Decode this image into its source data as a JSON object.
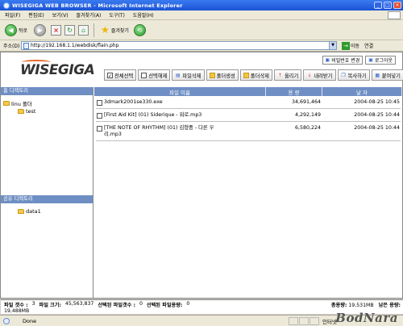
{
  "window": {
    "title": "WISEGIGA WEB BROWSER - Microsoft Internet Explorer",
    "controls": [
      "_",
      "□",
      "×"
    ]
  },
  "menu": [
    "파일(F)",
    "편집(E)",
    "보기(V)",
    "즐겨찾기(A)",
    "도구(T)",
    "도움말(H)"
  ],
  "toolbar": {
    "back_label": "뒤로",
    "favorites_label": "즐겨찾기"
  },
  "address": {
    "label": "주소(D)",
    "url": "http://192.168.1.1/webdisk/flain.php",
    "go_label": "이동",
    "links_label": "연결"
  },
  "app": {
    "logo": "WISEGIGA",
    "change_password": "비밀번호 변경",
    "logout": "로그아웃",
    "actions": [
      "전체선택",
      "선택해제",
      "파일삭제",
      "폴더생성",
      "폴더삭제",
      "올리기",
      "내려받기",
      "복사하기",
      "붙여넣기"
    ]
  },
  "left_panel": {
    "home_header": "홈 디렉토리",
    "home_folder": "linu 폴더",
    "home_child": "test",
    "share_header": "공유 디렉토리",
    "share_child": "data1"
  },
  "file_table": {
    "columns": [
      "파일 이름",
      "용 량",
      "날 자"
    ],
    "rows": [
      {
        "name": "3dmark2001se330.exe",
        "size": "34,691,464",
        "date": "2004-08-25 10:45"
      },
      {
        "name": "[First Aid Kit] (01) Siderique - 워로.mp3",
        "size": "4,292,149",
        "date": "2004-08-25 10:44"
      },
      {
        "name": "[THE NOTE OF RHYTHM] (01) 김형중 - 다른 우리.mp3",
        "size": "6,580,224",
        "date": "2004-08-25 10:44"
      }
    ]
  },
  "info": {
    "file_count_label": "파일 갯수 :",
    "file_count": "3",
    "file_size_label": "파일 크기:",
    "file_size": "45,563,837",
    "selected_count_label": "선택된 파일갯수 :",
    "selected_count": "0",
    "selected_size_label": "선택된 파일용량:",
    "selected_size": "0",
    "total_label": "총용량:",
    "total": "19,531MB",
    "remaining_label": "남은 용량:",
    "remaining": "19,488MB"
  },
  "status": {
    "text": "Done",
    "zone": "인터넷"
  },
  "watermark": "BodNara"
}
